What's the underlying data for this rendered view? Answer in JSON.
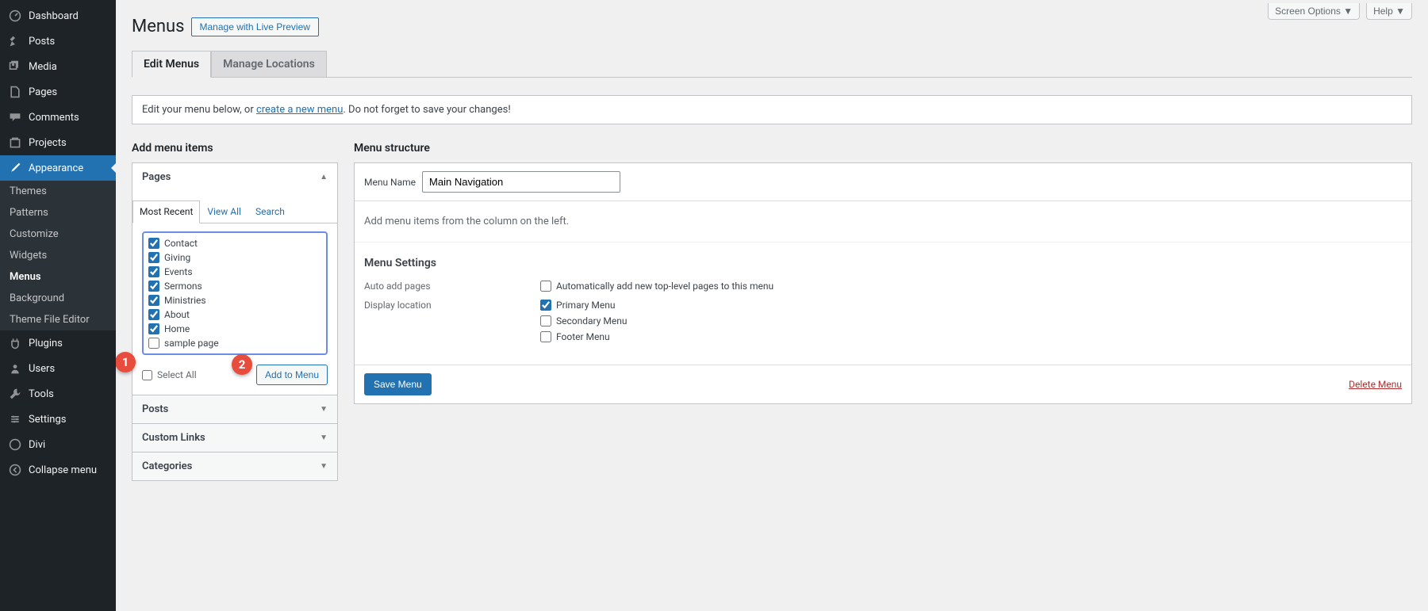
{
  "topbar": {
    "screen_options": "Screen Options",
    "help": "Help"
  },
  "header": {
    "title": "Menus",
    "action_button": "Manage with Live Preview"
  },
  "tabs": {
    "edit": "Edit Menus",
    "locations": "Manage Locations"
  },
  "notice": {
    "pre": "Edit your menu below, or ",
    "link": "create a new menu",
    "post": ". Do not forget to save your changes!"
  },
  "sidebar": {
    "dashboard": "Dashboard",
    "posts": "Posts",
    "media": "Media",
    "pages": "Pages",
    "comments": "Comments",
    "projects": "Projects",
    "appearance": "Appearance",
    "plugins": "Plugins",
    "users": "Users",
    "tools": "Tools",
    "settings": "Settings",
    "divi": "Divi",
    "collapse": "Collapse menu",
    "sub": {
      "themes": "Themes",
      "patterns": "Patterns",
      "customize": "Customize",
      "widgets": "Widgets",
      "menus": "Menus",
      "background": "Background",
      "tfe": "Theme File Editor"
    }
  },
  "left": {
    "heading": "Add menu items",
    "pages_label": "Pages",
    "filters": {
      "recent": "Most Recent",
      "view_all": "View All",
      "search": "Search"
    },
    "items": [
      {
        "label": "Contact",
        "checked": true
      },
      {
        "label": "Giving",
        "checked": true
      },
      {
        "label": "Events",
        "checked": true
      },
      {
        "label": "Sermons",
        "checked": true
      },
      {
        "label": "Ministries",
        "checked": true
      },
      {
        "label": "About",
        "checked": true
      },
      {
        "label": "Home",
        "checked": true
      },
      {
        "label": "sample page",
        "checked": false
      }
    ],
    "select_all": "Select All",
    "add_btn": "Add to Menu",
    "posts_label": "Posts",
    "custom_links_label": "Custom Links",
    "categories_label": "Categories"
  },
  "right": {
    "heading": "Menu structure",
    "menu_name_label": "Menu Name",
    "menu_name_value": "Main Navigation",
    "empty_msg": "Add menu items from the column on the left.",
    "settings_heading": "Menu Settings",
    "auto_label": "Auto add pages",
    "auto_opt": "Automatically add new top-level pages to this menu",
    "loc_label": "Display location",
    "loc_primary": "Primary Menu",
    "loc_secondary": "Secondary Menu",
    "loc_footer": "Footer Menu",
    "save": "Save Menu",
    "delete": "Delete Menu"
  },
  "badges": {
    "one": "1",
    "two": "2"
  }
}
